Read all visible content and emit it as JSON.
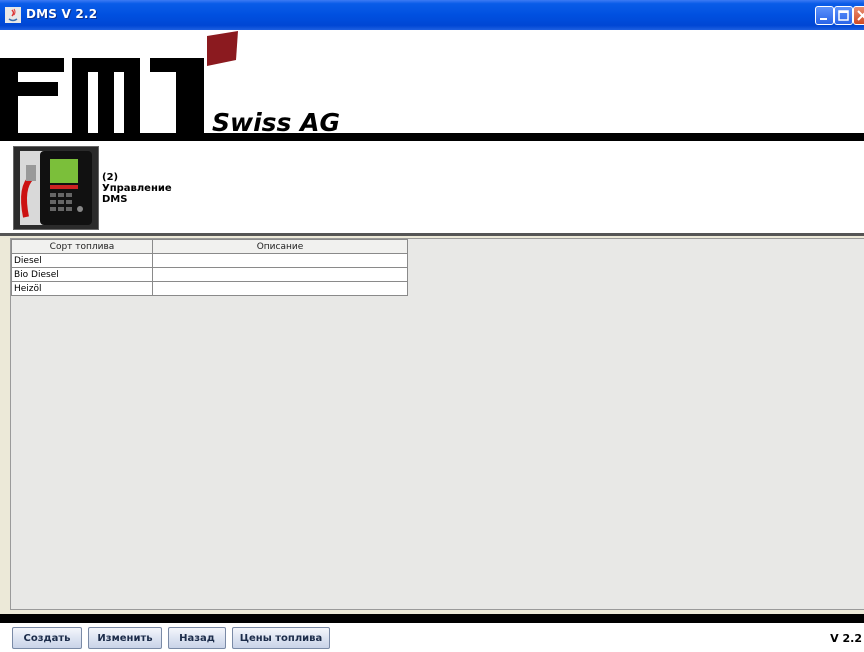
{
  "window": {
    "title": "DMS V 2.2",
    "controls": [
      "minimize-icon",
      "maximize-icon",
      "close-icon"
    ]
  },
  "logo": {
    "letters": "FMT",
    "tagline": "Swiss AG",
    "accent_color": "#8b1a1f"
  },
  "info": {
    "line1": "(2)",
    "line2": "Управление",
    "line3": "DMS"
  },
  "table": {
    "columns": [
      "Сорт топлива",
      "Описание"
    ],
    "rows": [
      [
        "Diesel",
        ""
      ],
      [
        "Bio Diesel",
        ""
      ],
      [
        "Heizöl",
        ""
      ]
    ]
  },
  "buttons": {
    "create": "Создать",
    "edit": "Изменить",
    "back": "Назад",
    "fuel_prices": "Цены топлива"
  },
  "version": "V 2.2"
}
